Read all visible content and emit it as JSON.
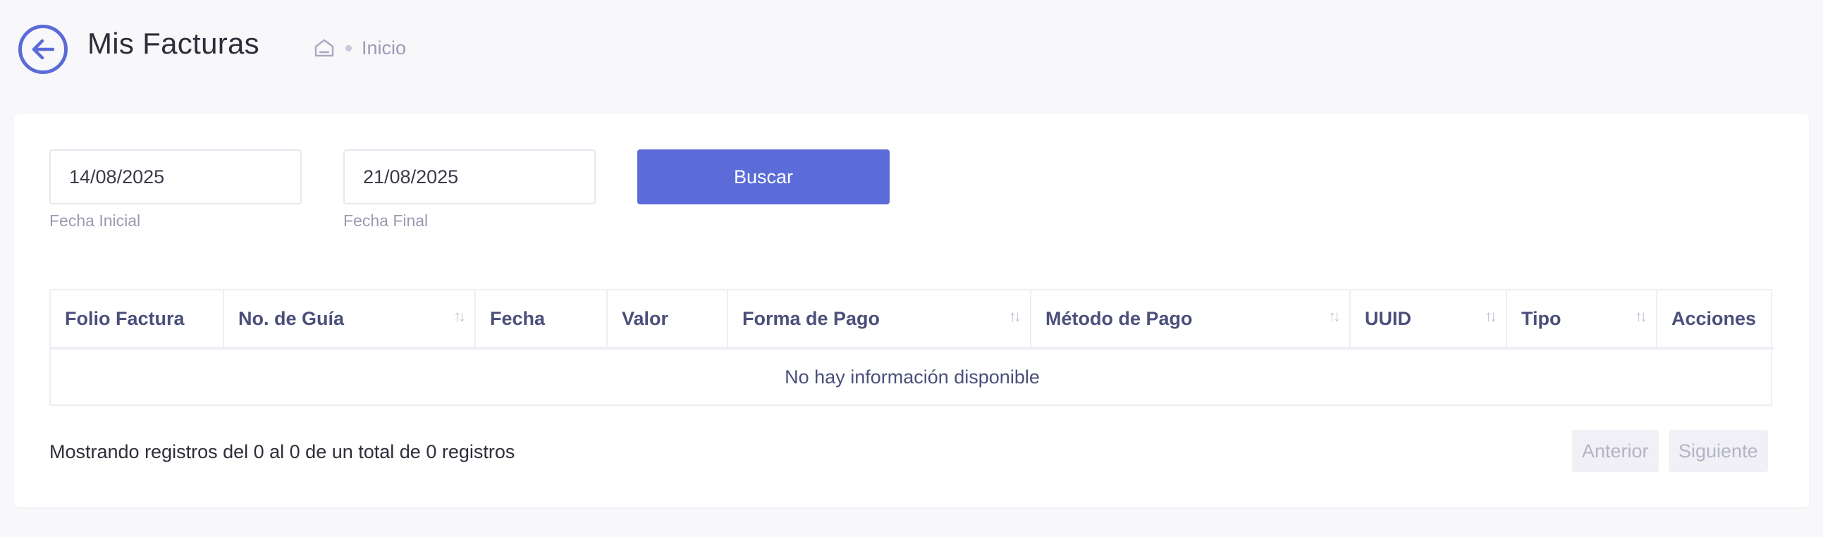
{
  "header": {
    "title": "Mis Facturas",
    "breadcrumb": [
      "Inicio"
    ]
  },
  "filters": {
    "start_date": "14/08/2025",
    "start_label": "Fecha Inicial",
    "end_date": "21/08/2025",
    "end_label": "Fecha Final",
    "search_label": "Buscar"
  },
  "table": {
    "columns": [
      {
        "label": "Folio Factura",
        "sortable": false
      },
      {
        "label": "No. de Guía",
        "sortable": true
      },
      {
        "label": "Fecha",
        "sortable": false
      },
      {
        "label": "Valor",
        "sortable": false
      },
      {
        "label": "Forma de Pago",
        "sortable": true
      },
      {
        "label": "Método de Pago",
        "sortable": true
      },
      {
        "label": "UUID",
        "sortable": true
      },
      {
        "label": "Tipo",
        "sortable": true
      },
      {
        "label": "Acciones",
        "sortable": false
      }
    ],
    "empty_message": "No hay información disponible"
  },
  "footer": {
    "info": "Mostrando registros del 0 al 0 de un total de 0 registros",
    "prev_label": "Anterior",
    "next_label": "Siguiente"
  },
  "colors": {
    "accent": "#5b6cd8",
    "heading_text": "#4b4f7a",
    "muted": "#9a9ab8"
  },
  "icons": {
    "back": "arrow-left-circle-icon",
    "home": "home-icon",
    "sort": "sort-arrows-icon"
  }
}
